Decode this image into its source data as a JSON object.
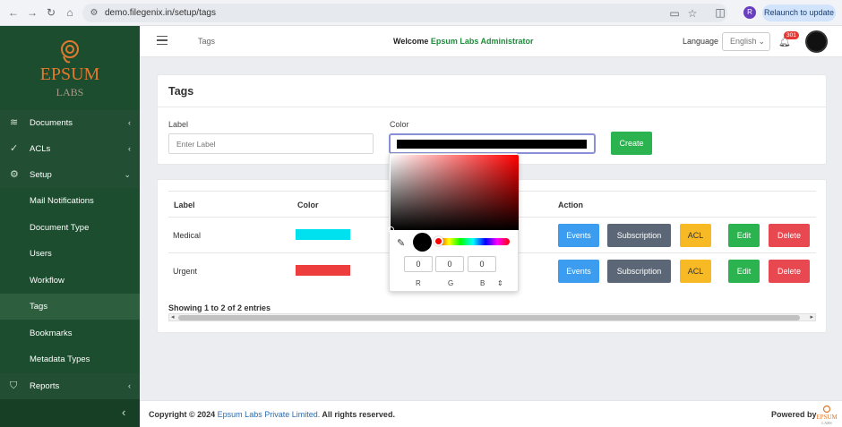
{
  "browser": {
    "url": "demo.filegenix.in/setup/tags",
    "relaunch_label": "Relaunch to update",
    "profile_initial": "R"
  },
  "sidebar": {
    "logo_text": "EPSUM",
    "logo_sub": "LABS",
    "items": [
      {
        "label": "Documents",
        "icon": "layers-icon"
      },
      {
        "label": "ACLs",
        "icon": "check-circle-icon"
      },
      {
        "label": "Setup",
        "icon": "gear-icon"
      },
      {
        "label": "Mail Notifications"
      },
      {
        "label": "Document Type"
      },
      {
        "label": "Users"
      },
      {
        "label": "Workflow"
      },
      {
        "label": "Tags"
      },
      {
        "label": "Bookmarks"
      },
      {
        "label": "Metadata Types"
      },
      {
        "label": "Reports",
        "icon": "shield-icon"
      }
    ]
  },
  "topbar": {
    "breadcrumb": "Tags",
    "welcome_prefix": "Welcome",
    "welcome_name": "Epsum Labs Administrator",
    "language_label": "Language",
    "language_value": "English",
    "notification_count": "301"
  },
  "form": {
    "title": "Tags",
    "label_field_label": "Label",
    "label_placeholder": "Enter Label",
    "color_field_label": "Color",
    "color_value": "#000000",
    "create_label": "Create"
  },
  "table": {
    "headers": {
      "label": "Label",
      "color": "Color",
      "action": "Action"
    },
    "rows": [
      {
        "label": "Medical",
        "color": "#00e1f0"
      },
      {
        "label": "Urgent",
        "color": "#ee3d3d"
      }
    ],
    "actions": {
      "events": "Events",
      "subscription": "Subscription",
      "acl": "ACL",
      "edit": "Edit",
      "delete": "Delete"
    },
    "info": "Showing 1 to 2 of 2 entries"
  },
  "picker": {
    "r": "0",
    "g": "0",
    "b": "0",
    "r_label": "R",
    "g_label": "G",
    "b_label": "B",
    "switch_glyph": "⇕"
  },
  "footer": {
    "prefix": "Copyright © 2024",
    "company": "Epsum Labs Private Limited.",
    "suffix": "All rights reserved.",
    "powered_by": "Powered by"
  },
  "colors": {
    "sidebar": "#1b4d2e",
    "accent_green": "#2bb34f",
    "events_blue": "#3b9cf0",
    "subscription_gray": "#5b6776",
    "acl_yellow": "#f7b924",
    "delete_red": "#e8484f"
  }
}
